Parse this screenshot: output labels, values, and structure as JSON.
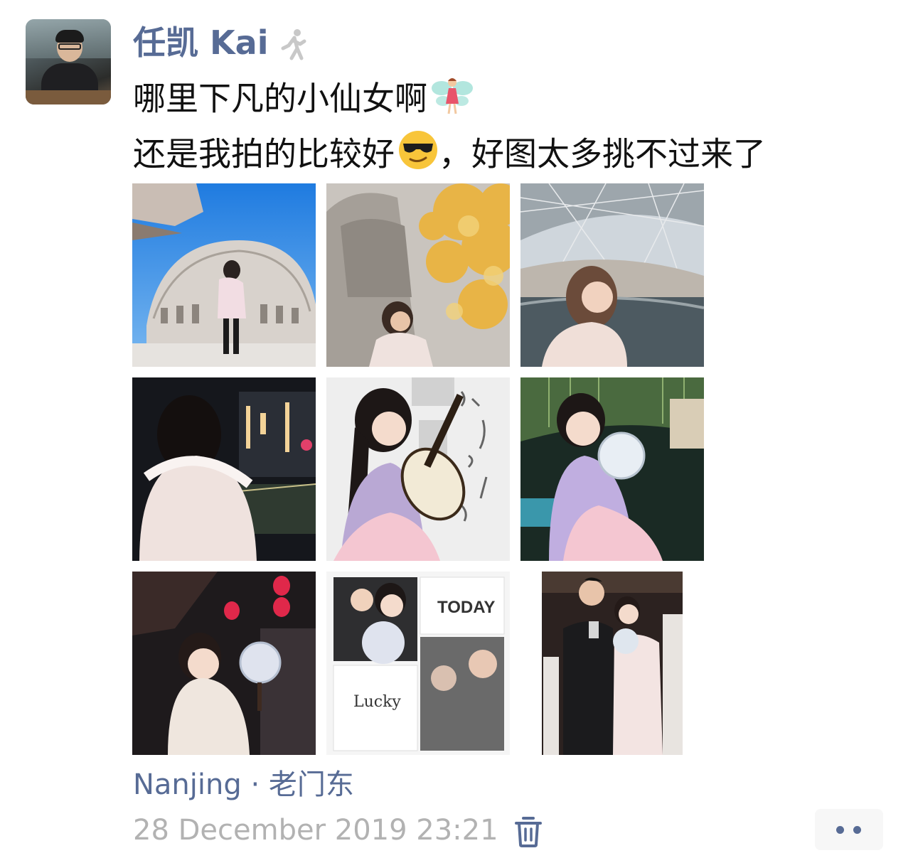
{
  "post": {
    "author": "任凯 Kai",
    "text_line1": "哪里下凡的小仙女啊",
    "text_line2_a": "还是我拍的比较好",
    "text_line2_b": "，好图太多挑不过来了",
    "emoji1": "fairy-emoji",
    "emoji2": "sunglasses-emoji",
    "status_icon": "walking-person-icon",
    "location": "Nanjing · 老门东",
    "timestamp": "28 December 2019 23:21"
  },
  "photos": [
    {
      "name": "photo-1",
      "scene": "girl-in-front-of-dome-building"
    },
    {
      "name": "photo-2",
      "scene": "girl-with-golden-ginkgo-tree"
    },
    {
      "name": "photo-3",
      "scene": "girl-by-reflecting-pool"
    },
    {
      "name": "photo-4",
      "scene": "girl-in-white-hood-at-night"
    },
    {
      "name": "photo-5",
      "scene": "girl-playing-pipa"
    },
    {
      "name": "photo-6",
      "scene": "girl-with-round-fan-by-willow"
    },
    {
      "name": "photo-7",
      "scene": "girl-with-fan-red-lanterns"
    },
    {
      "name": "photo-8",
      "scene": "photo-collage",
      "labels": [
        "TODAY",
        "Lucky"
      ]
    },
    {
      "name": "photo-9",
      "scene": "couple-mirror-selfie"
    }
  ],
  "colors": {
    "link": "#576b95",
    "text": "#111111",
    "muted": "#b2b2b2"
  }
}
